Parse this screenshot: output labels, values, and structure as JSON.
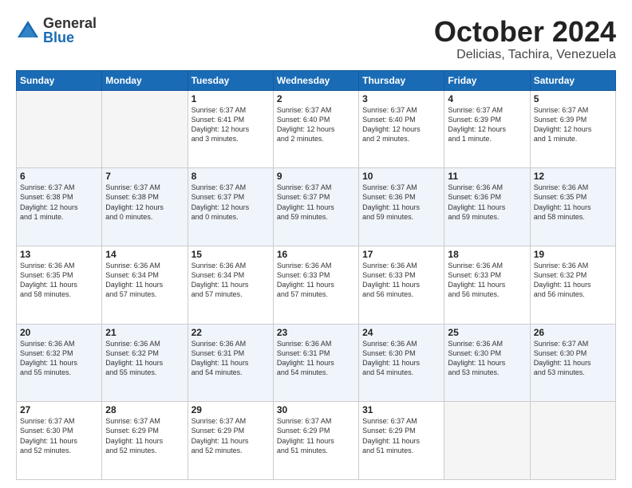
{
  "logo": {
    "general": "General",
    "blue": "Blue"
  },
  "title": "October 2024",
  "location": "Delicias, Tachira, Venezuela",
  "days_of_week": [
    "Sunday",
    "Monday",
    "Tuesday",
    "Wednesday",
    "Thursday",
    "Friday",
    "Saturday"
  ],
  "weeks": [
    [
      {
        "day": "",
        "info": ""
      },
      {
        "day": "",
        "info": ""
      },
      {
        "day": "1",
        "info": "Sunrise: 6:37 AM\nSunset: 6:41 PM\nDaylight: 12 hours\nand 3 minutes."
      },
      {
        "day": "2",
        "info": "Sunrise: 6:37 AM\nSunset: 6:40 PM\nDaylight: 12 hours\nand 2 minutes."
      },
      {
        "day": "3",
        "info": "Sunrise: 6:37 AM\nSunset: 6:40 PM\nDaylight: 12 hours\nand 2 minutes."
      },
      {
        "day": "4",
        "info": "Sunrise: 6:37 AM\nSunset: 6:39 PM\nDaylight: 12 hours\nand 1 minute."
      },
      {
        "day": "5",
        "info": "Sunrise: 6:37 AM\nSunset: 6:39 PM\nDaylight: 12 hours\nand 1 minute."
      }
    ],
    [
      {
        "day": "6",
        "info": "Sunrise: 6:37 AM\nSunset: 6:38 PM\nDaylight: 12 hours\nand 1 minute."
      },
      {
        "day": "7",
        "info": "Sunrise: 6:37 AM\nSunset: 6:38 PM\nDaylight: 12 hours\nand 0 minutes."
      },
      {
        "day": "8",
        "info": "Sunrise: 6:37 AM\nSunset: 6:37 PM\nDaylight: 12 hours\nand 0 minutes."
      },
      {
        "day": "9",
        "info": "Sunrise: 6:37 AM\nSunset: 6:37 PM\nDaylight: 11 hours\nand 59 minutes."
      },
      {
        "day": "10",
        "info": "Sunrise: 6:37 AM\nSunset: 6:36 PM\nDaylight: 11 hours\nand 59 minutes."
      },
      {
        "day": "11",
        "info": "Sunrise: 6:36 AM\nSunset: 6:36 PM\nDaylight: 11 hours\nand 59 minutes."
      },
      {
        "day": "12",
        "info": "Sunrise: 6:36 AM\nSunset: 6:35 PM\nDaylight: 11 hours\nand 58 minutes."
      }
    ],
    [
      {
        "day": "13",
        "info": "Sunrise: 6:36 AM\nSunset: 6:35 PM\nDaylight: 11 hours\nand 58 minutes."
      },
      {
        "day": "14",
        "info": "Sunrise: 6:36 AM\nSunset: 6:34 PM\nDaylight: 11 hours\nand 57 minutes."
      },
      {
        "day": "15",
        "info": "Sunrise: 6:36 AM\nSunset: 6:34 PM\nDaylight: 11 hours\nand 57 minutes."
      },
      {
        "day": "16",
        "info": "Sunrise: 6:36 AM\nSunset: 6:33 PM\nDaylight: 11 hours\nand 57 minutes."
      },
      {
        "day": "17",
        "info": "Sunrise: 6:36 AM\nSunset: 6:33 PM\nDaylight: 11 hours\nand 56 minutes."
      },
      {
        "day": "18",
        "info": "Sunrise: 6:36 AM\nSunset: 6:33 PM\nDaylight: 11 hours\nand 56 minutes."
      },
      {
        "day": "19",
        "info": "Sunrise: 6:36 AM\nSunset: 6:32 PM\nDaylight: 11 hours\nand 56 minutes."
      }
    ],
    [
      {
        "day": "20",
        "info": "Sunrise: 6:36 AM\nSunset: 6:32 PM\nDaylight: 11 hours\nand 55 minutes."
      },
      {
        "day": "21",
        "info": "Sunrise: 6:36 AM\nSunset: 6:32 PM\nDaylight: 11 hours\nand 55 minutes."
      },
      {
        "day": "22",
        "info": "Sunrise: 6:36 AM\nSunset: 6:31 PM\nDaylight: 11 hours\nand 54 minutes."
      },
      {
        "day": "23",
        "info": "Sunrise: 6:36 AM\nSunset: 6:31 PM\nDaylight: 11 hours\nand 54 minutes."
      },
      {
        "day": "24",
        "info": "Sunrise: 6:36 AM\nSunset: 6:30 PM\nDaylight: 11 hours\nand 54 minutes."
      },
      {
        "day": "25",
        "info": "Sunrise: 6:36 AM\nSunset: 6:30 PM\nDaylight: 11 hours\nand 53 minutes."
      },
      {
        "day": "26",
        "info": "Sunrise: 6:37 AM\nSunset: 6:30 PM\nDaylight: 11 hours\nand 53 minutes."
      }
    ],
    [
      {
        "day": "27",
        "info": "Sunrise: 6:37 AM\nSunset: 6:30 PM\nDaylight: 11 hours\nand 52 minutes."
      },
      {
        "day": "28",
        "info": "Sunrise: 6:37 AM\nSunset: 6:29 PM\nDaylight: 11 hours\nand 52 minutes."
      },
      {
        "day": "29",
        "info": "Sunrise: 6:37 AM\nSunset: 6:29 PM\nDaylight: 11 hours\nand 52 minutes."
      },
      {
        "day": "30",
        "info": "Sunrise: 6:37 AM\nSunset: 6:29 PM\nDaylight: 11 hours\nand 51 minutes."
      },
      {
        "day": "31",
        "info": "Sunrise: 6:37 AM\nSunset: 6:29 PM\nDaylight: 11 hours\nand 51 minutes."
      },
      {
        "day": "",
        "info": ""
      },
      {
        "day": "",
        "info": ""
      }
    ]
  ]
}
